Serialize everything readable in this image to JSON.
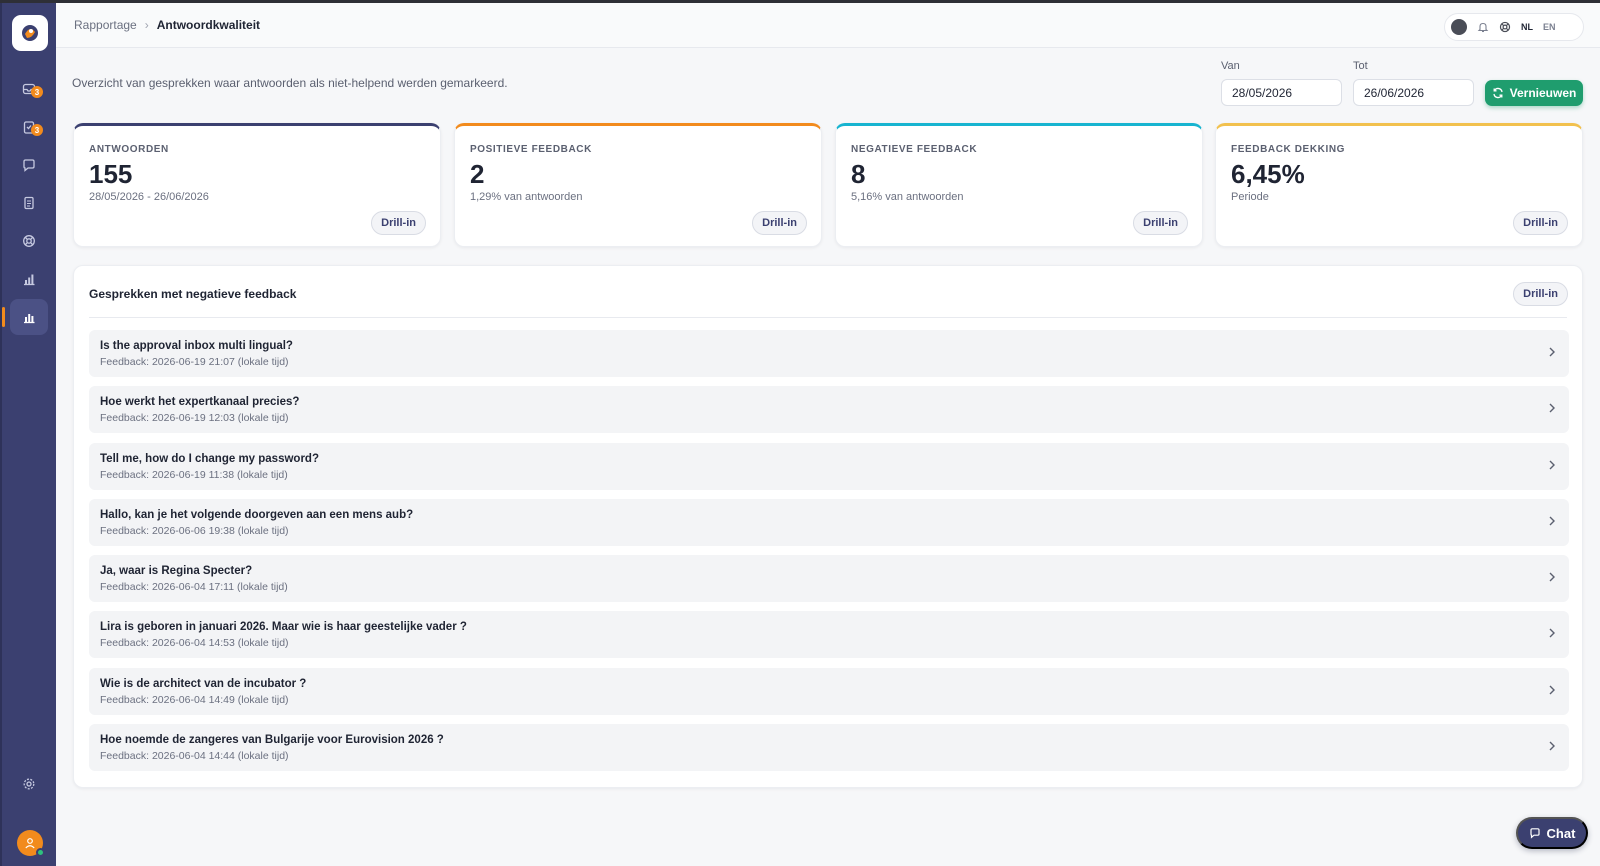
{
  "breadcrumb": {
    "parent": "Rapportage",
    "current": "Antwoordkwaliteit"
  },
  "header": {
    "lang_nl": "NL",
    "lang_en": "EN"
  },
  "sidebar": {
    "badges": [
      "3",
      "3"
    ]
  },
  "intro": "Overzicht van gesprekken waar antwoorden als niet-helpend werden gemarkeerd.",
  "filters": {
    "from_label": "Van",
    "from_value": "28/05/2026",
    "to_label": "Tot",
    "to_value": "26/06/2026",
    "refresh_label": "Vernieuwen"
  },
  "cards": [
    {
      "label": "ANTWOORDEN",
      "value": "155",
      "sub": "28/05/2026 - 26/06/2026",
      "drill": "Drill-in",
      "color": "#3b4070"
    },
    {
      "label": "POSITIEVE FEEDBACK",
      "value": "2",
      "sub": "1,29% van antwoorden",
      "drill": "Drill-in",
      "color": "#f28b1d"
    },
    {
      "label": "NEGATIEVE FEEDBACK",
      "value": "8",
      "sub": "5,16% van antwoorden",
      "drill": "Drill-in",
      "color": "#17b4d0"
    },
    {
      "label": "FEEDBACK DEKKING",
      "value": "6,45%",
      "sub": "Periode",
      "drill": "Drill-in",
      "color": "#f2c14e"
    }
  ],
  "panel": {
    "title": "Gesprekken met negatieve feedback",
    "drill": "Drill-in",
    "items": [
      {
        "question": "Is the approval inbox multi lingual?",
        "meta": "Feedback: 2026-06-19 21:07 (lokale tijd)"
      },
      {
        "question": "Hoe werkt het expertkanaal precies?",
        "meta": "Feedback: 2026-06-19 12:03 (lokale tijd)"
      },
      {
        "question": "Tell me, how do I change my password?",
        "meta": "Feedback: 2026-06-19 11:38 (lokale tijd)"
      },
      {
        "question": "Hallo, kan je het volgende doorgeven aan een mens aub?",
        "meta": "Feedback: 2026-06-06 19:38 (lokale tijd)"
      },
      {
        "question": "Ja, waar is Regina Specter?",
        "meta": "Feedback: 2026-06-04 17:11 (lokale tijd)"
      },
      {
        "question": "Lira is geboren in januari 2026. Maar wie is haar geestelijke vader ?",
        "meta": "Feedback: 2026-06-04 14:53 (lokale tijd)"
      },
      {
        "question": "Wie is de architect van de incubator ?",
        "meta": "Feedback: 2026-06-04 14:49 (lokale tijd)"
      },
      {
        "question": "Hoe noemde de zangeres van Bulgarije voor Eurovision 2026 ?",
        "meta": "Feedback: 2026-06-04 14:44 (lokale tijd)"
      }
    ]
  },
  "chat": {
    "label": "Chat"
  }
}
